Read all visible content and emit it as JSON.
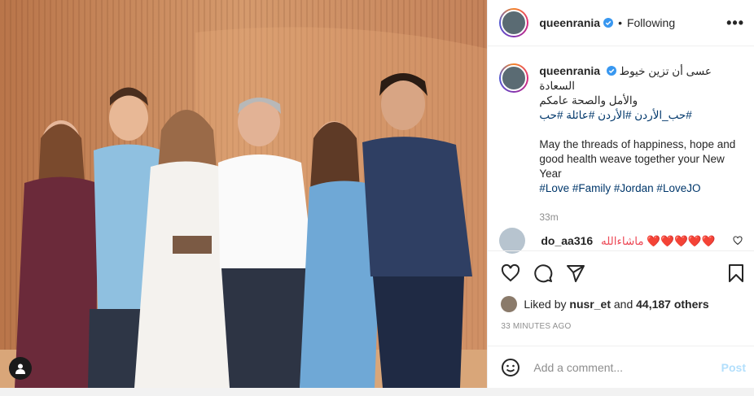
{
  "header": {
    "username": "queenrania",
    "separator": "•",
    "follow_status": "Following",
    "more": "•••"
  },
  "caption": {
    "username": "queenrania",
    "arabic_line1": "عسى أن تزين خيوط السعادة",
    "arabic_line2": "والأمل والصحة عامكم",
    "arabic_tags": "#حب_الأردن #الأردن #عائلة #حب",
    "english_text": "May the threads of happiness, hope and good health weave together your New Year",
    "english_tags": "#Love #Family #Jordan #LoveJO",
    "time": "33m"
  },
  "comment": {
    "username": "do_aa316",
    "text": "ماشاءالله ❤️❤️❤️❤️❤️"
  },
  "likes": {
    "prefix": "Liked by ",
    "user": "nusr_et",
    "middle": " and ",
    "count": "44,187 others"
  },
  "timestamp": "33 MINUTES AGO",
  "add_comment": {
    "placeholder": "Add a comment...",
    "post_label": "Post"
  },
  "colors": {
    "link": "#00376b",
    "verified": "#3897f0",
    "heart": "#ed4956",
    "post_disabled": "#b2dffc"
  },
  "icons": [
    "tag-user-icon",
    "verified-icon",
    "more-icon",
    "heart-icon",
    "comment-icon",
    "share-icon",
    "save-icon",
    "emoji-icon"
  ]
}
